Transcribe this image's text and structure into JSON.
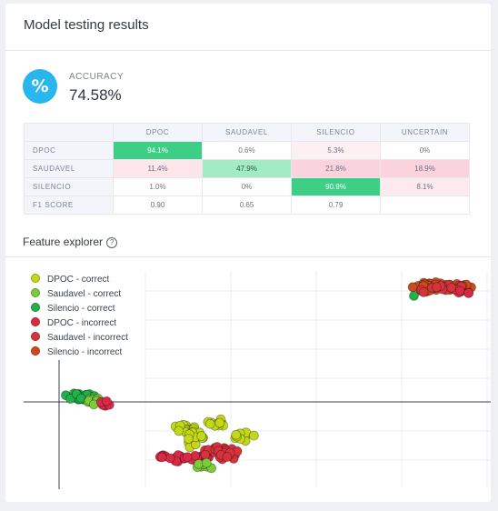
{
  "card": {
    "title": "Model testing results"
  },
  "accuracy": {
    "icon": "%",
    "label": "ACCURACY",
    "value": "74.58%"
  },
  "matrix": {
    "columns": [
      "",
      "DPOC",
      "SAUDAVEL",
      "SILENCIO",
      "UNCERTAIN"
    ],
    "rows": [
      {
        "label": "DPOC",
        "cells": [
          "94.1%",
          "0.6%",
          "5.3%",
          "0%"
        ],
        "bg": [
          "#3ecf86",
          "#ffffff",
          "#fdf0f2",
          "#ffffff"
        ],
        "fg": [
          "#ffffff",
          "#6b7383",
          "#6b7383",
          "#6b7383"
        ]
      },
      {
        "label": "SAUDAVEL",
        "cells": [
          "11.4%",
          "47.9%",
          "21.8%",
          "18.9%"
        ],
        "bg": [
          "#fde5ea",
          "#a3ebc3",
          "#fbd3dc",
          "#fbd3dc"
        ],
        "fg": [
          "#6b7383",
          "#2f5a45",
          "#6b7383",
          "#6b7383"
        ]
      },
      {
        "label": "SILENCIO",
        "cells": [
          "1.0%",
          "0%",
          "90.9%",
          "8.1%"
        ],
        "bg": [
          "#ffffff",
          "#ffffff",
          "#3ecf86",
          "#fdeaef"
        ],
        "fg": [
          "#6b7383",
          "#6b7383",
          "#ffffff",
          "#6b7383"
        ]
      },
      {
        "label": "F1 SCORE",
        "cells": [
          "0.90",
          "0.65",
          "0.79",
          ""
        ],
        "bg": [
          "#ffffff",
          "#ffffff",
          "#ffffff",
          "#ffffff"
        ],
        "fg": [
          "#6b7383",
          "#6b7383",
          "#6b7383",
          "#6b7383"
        ]
      }
    ]
  },
  "explorer": {
    "title": "Feature explorer",
    "help_icon": "help-circle-icon",
    "help_glyph": "?"
  },
  "legend": [
    {
      "label": "DPOC - correct",
      "color": "#c3d818"
    },
    {
      "label": "Saudavel - correct",
      "color": "#7ccc3a"
    },
    {
      "label": "Silencio - correct",
      "color": "#22b04a"
    },
    {
      "label": "DPOC - incorrect",
      "color": "#d92a45"
    },
    {
      "label": "Saudavel - incorrect",
      "color": "#d6343c"
    },
    {
      "label": "Silencio - incorrect",
      "color": "#cc4a1e"
    }
  ]
}
